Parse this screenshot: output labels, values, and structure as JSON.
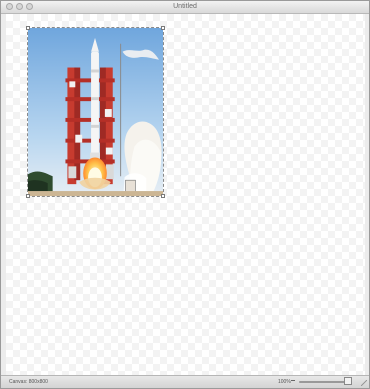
{
  "window": {
    "title": "Untitled"
  },
  "canvas": {
    "image_subject": "rocket launch photo"
  },
  "status_bar": {
    "canvas_size_text": "Canvas: 800x800",
    "zoom_text": "100%",
    "zoom_level": 1.0
  },
  "icons": {
    "close": "close-icon",
    "minimize": "minimize-icon",
    "zoom": "zoom-icon",
    "zoom_minus": "minus-icon",
    "zoom_plus": "plus-icon",
    "resize": "resize-grip-icon"
  },
  "colors": {
    "sky_top": "#7fb3e6",
    "sky_bottom": "#d7e7f5",
    "tower_red": "#c7352a",
    "rocket_white": "#f4f4f4",
    "flame": "#ffd36b",
    "smoke": "#f3f0ea"
  }
}
